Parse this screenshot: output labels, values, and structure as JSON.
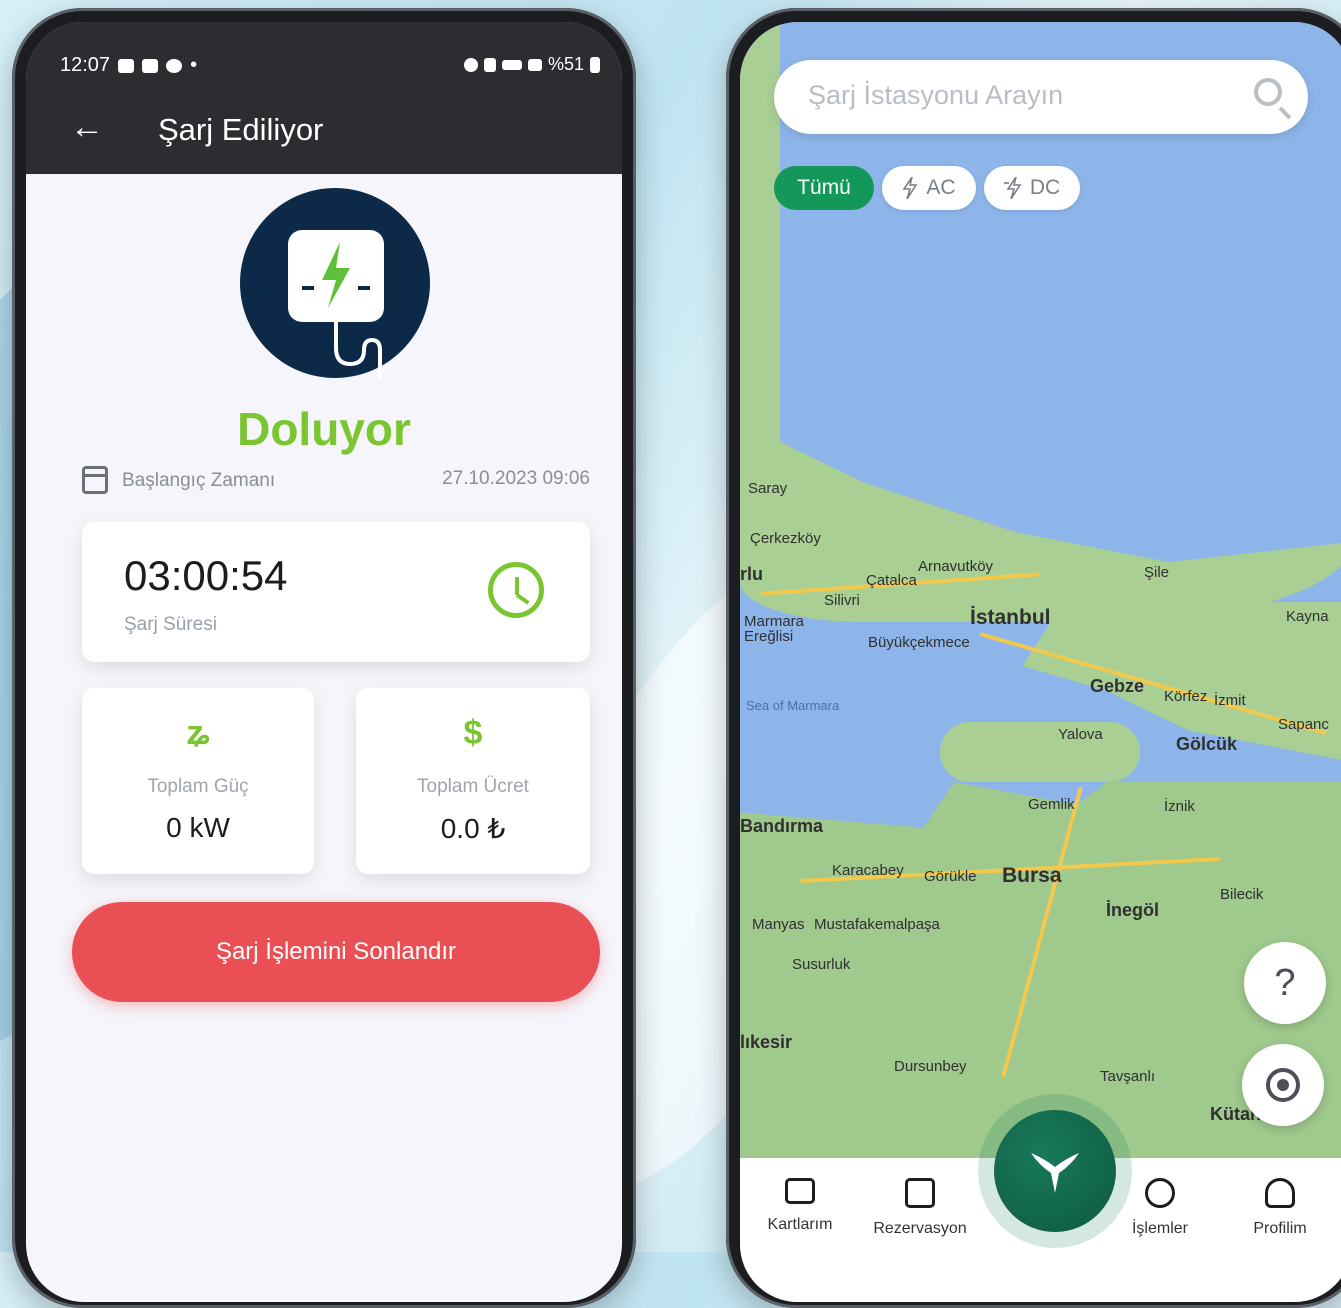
{
  "left_screen": {
    "status_bar": {
      "time": "12:07",
      "dot": "•",
      "battery": "%51"
    },
    "header": {
      "back": "←",
      "title": "Şarj Ediliyor"
    },
    "status_word": "Doluyor",
    "start": {
      "label": "Başlangıç Zamanı",
      "value": "27.10.2023 09:06"
    },
    "duration": {
      "value": "03:00:54",
      "label": "Şarj Süresi"
    },
    "power": {
      "icon": "plug-icon",
      "icon_glyph": "ʑ",
      "label": "Toplam Güç",
      "value": "0 kW"
    },
    "fee": {
      "icon": "dollar-icon",
      "icon_glyph": "$",
      "label": "Toplam Ücret",
      "value": "0.0 ₺"
    },
    "end_button": "Şarj İşlemini Sonlandır",
    "accent": "#7ac530",
    "danger": "#e94f55"
  },
  "right_screen": {
    "search": {
      "placeholder": "Şarj İstasyonu Arayın"
    },
    "filters": [
      {
        "label": "Tümü",
        "active": true
      },
      {
        "label": "AC",
        "icon": "lightning-icon"
      },
      {
        "label": "DC",
        "icon": "lightning-fast-icon"
      }
    ],
    "map_labels": {
      "saray": "Saray",
      "cerkezkoy": "Çerkezköy",
      "corlu": "rlu",
      "catalca": "Çatalca",
      "arnavutkoy": "Arnavutköy",
      "sile": "Şile",
      "silivri": "Silivri",
      "marmara_ereglisi": "Marmara Ereğlisi",
      "buyukcekmece": "Büyükçekmece",
      "istanbul": "İstanbul",
      "kaynarca": "Kayna",
      "gebze": "Gebze",
      "korfez": "Körfez",
      "izmit": "İzmit",
      "sapanca": "Sapanc",
      "sea_of_marmara": "Sea of Marmara",
      "yalova": "Yalova",
      "golcuk": "Gölcük",
      "gemlik": "Gemlik",
      "iznik": "İznik",
      "bandirma": "Bandırma",
      "karacabey": "Karacabey",
      "gorukle": "Görükle",
      "bursa": "Bursa",
      "bilecik": "Bilecik",
      "inegol": "İnegöl",
      "manyas": "Manyas",
      "mustafakemalpasa": "Mustafakemalpaşa",
      "susurluk": "Susurluk",
      "balikesir": "lıkesir",
      "dursunbey": "Dursunbey",
      "tavsanli": "Tavşanlı",
      "kutahya": "Kütah"
    },
    "help": "?",
    "nav": [
      {
        "label": "Kartlarım",
        "icon": "card-icon"
      },
      {
        "label": "Rezervasyon",
        "icon": "calendar-icon"
      },
      {
        "label": "İşlemler",
        "icon": "clock-icon"
      },
      {
        "label": "Profilim",
        "icon": "user-icon"
      }
    ],
    "brand_color": "#13985a"
  }
}
